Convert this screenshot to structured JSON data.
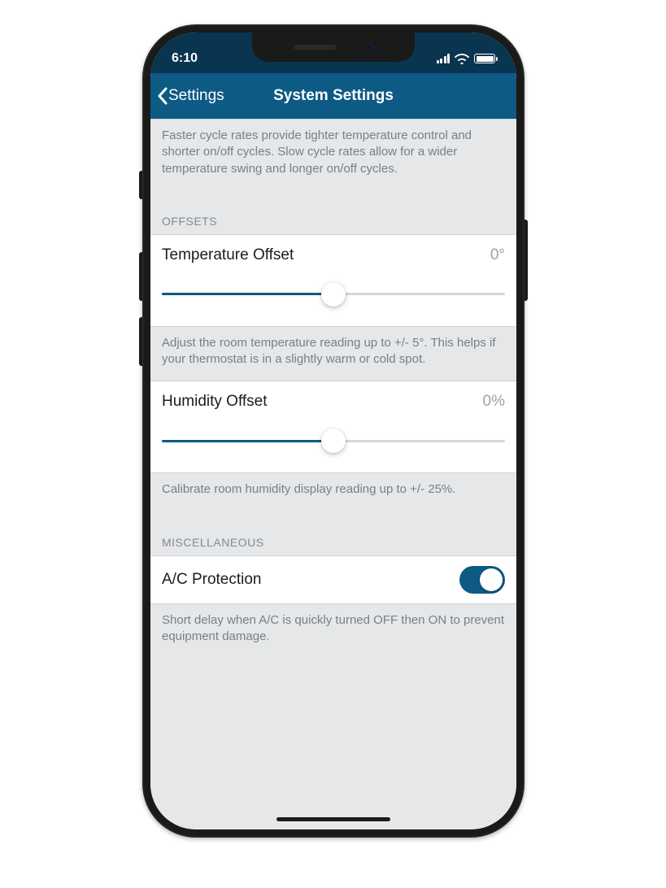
{
  "status": {
    "time": "6:10"
  },
  "nav": {
    "back_label": "Settings",
    "title": "System Settings"
  },
  "cycle_rate": {
    "help": "Faster cycle rates provide tighter temperature control and shorter on/off cycles. Slow cycle rates allow for a wider temperature swing and longer on/off cycles."
  },
  "offsets": {
    "header": "OFFSETS",
    "temperature": {
      "label": "Temperature Offset",
      "value": "0°",
      "help": "Adjust the room temperature reading up to +/- 5°. This helps if your thermostat is in a slightly warm or cold spot.",
      "slider_percent": 50
    },
    "humidity": {
      "label": "Humidity Offset",
      "value": "0%",
      "help": "Calibrate room humidity display reading up to +/- 25%.",
      "slider_percent": 50
    }
  },
  "miscellaneous": {
    "header": "MISCELLANEOUS",
    "ac_protection": {
      "label": "A/C Protection",
      "on": true,
      "help": "Short delay when A/C is quickly turned OFF then ON to prevent equipment damage."
    }
  }
}
